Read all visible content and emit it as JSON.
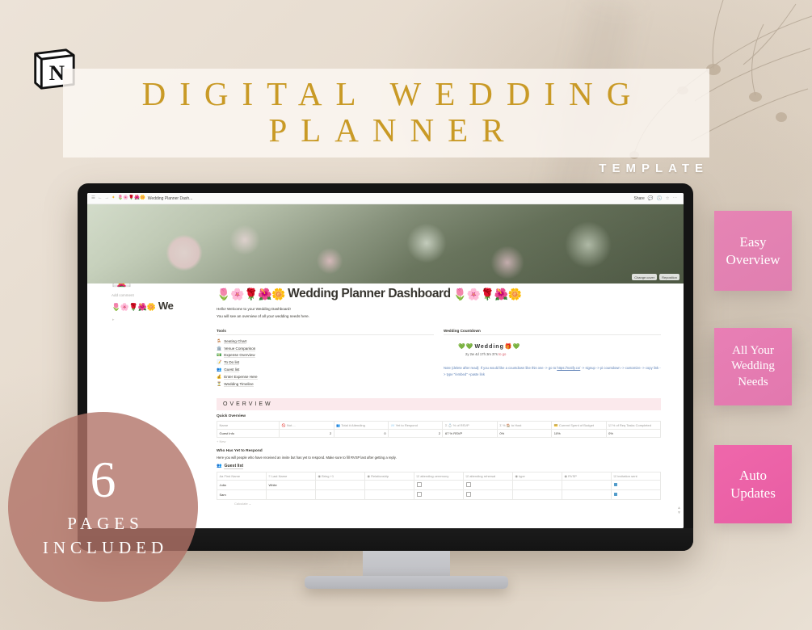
{
  "poster": {
    "title_line1": "DIGITAL WEDDING",
    "title_line2": "PLANNER",
    "template_word": "TEMPLATE",
    "logo_letter": "N",
    "badges": [
      {
        "text": "Easy\nOverview"
      },
      {
        "text": "All Your\nWedding\nNeeds"
      },
      {
        "text": "Auto\nUpdates"
      }
    ],
    "badge1_line1": "Easy",
    "badge1_line2": "Overview",
    "badge2_line1": "All Your",
    "badge2_line2": "Wedding",
    "badge2_line3": "Needs",
    "badge3_line1": "Auto",
    "badge3_line2": "Updates",
    "circle_number": "6",
    "circle_line1": "PAGES",
    "circle_line2": "INCLUDED",
    "accent_gold": "#c99a26",
    "accent_pink": "#e87fb5",
    "accent_rose": "#b27368"
  },
  "notion": {
    "topbar": {
      "menu_icon": "☰",
      "back_icon": "←",
      "forward_icon": "→",
      "star_icon": "✦",
      "breadcrumb_emojis": "🌷🌸🌹🌺🌼",
      "breadcrumb": "Wedding Planner Dash...",
      "share_label": "Share",
      "comment_icon": "💬",
      "clock_icon": "🕓",
      "favorite_icon": "☆",
      "more_icon": "⋯"
    },
    "cover": {
      "change_cover_label": "Change cover",
      "reposition_label": "Reposition"
    },
    "page": {
      "page_icon": "👰",
      "add_comment_label": "Add comment",
      "left_title_emojis": "🌷🌸🌹🌺🌼",
      "left_title_text": "We",
      "title_emojis_left": "🌷🌸🌹🌺🌼",
      "title": "Wedding Planner Dashboard",
      "title_emojis_right": "🌷🌸🌹🌺🌼",
      "intro_line1": "Hello! Welcome to your Wedding Dashboard!",
      "intro_line2": "You will see an overview of all your wedding needs here."
    },
    "tools": {
      "heading": "Tools",
      "items": [
        {
          "emoji": "🪑",
          "label": "Seating Chart"
        },
        {
          "emoji": "🏛️",
          "label": "Venue Comparison"
        },
        {
          "emoji": "💵",
          "label": "Expense Overview"
        },
        {
          "emoji": "📝",
          "label": "To Do list"
        },
        {
          "emoji": "👥",
          "label": "Guest list"
        },
        {
          "emoji": "💰",
          "label": "Enter Expense Here"
        },
        {
          "emoji": "⏳",
          "label": "Wedding Timeline"
        }
      ]
    },
    "countdown": {
      "heading": "Wedding Countdown",
      "widget_emoji_left": "💚💚",
      "widget_title": "Wedding",
      "widget_emoji_right": "🎁💚",
      "time_remaining": "2y 2w 4d 17h 3m 37s",
      "time_suffix": "to go",
      "note": "Note (delete after read): If you would like a countdown like this one -> go to",
      "note_link": "https://notify.co/",
      "note_tail": "-> signup -> pi countdown -> customize -> copy link -> type \"/embed\" +paste link"
    },
    "overview": {
      "band_title": "OVERVIEW",
      "quick_overview_heading": "Quick Overview",
      "columns": [
        "Name",
        "🚫 Not ...",
        "👥 Total # Attending",
        "📨 Yet to Respond",
        "Σ 💍 % of RSVP",
        "Σ % 🏠 to Host",
        "💳 Current Spent of Budget",
        "☑ % of Req Tasks Completed"
      ],
      "rows": [
        {
          "name": "Guest Info",
          "not_attending": "2",
          "total_attending": "0",
          "yet_to_respond": "2",
          "pct_rsvp": "67 % RSVP",
          "pct_to_host": "0%",
          "current_spent": "10%",
          "pct_tasks": "0%"
        }
      ],
      "new_row_label": "+ New"
    },
    "respond": {
      "heading": "Who Has Yet to Respond",
      "description": "Here you will people who have received an invite but has yet to respond. Make sure to fill RVSP last after getting a reply.",
      "db_emoji": "👥",
      "db_title": "Guest list",
      "columns": [
        "Aa First Name",
        "≡ Last Name",
        "◉ Bring +1",
        "◉ Relationship",
        "☑ attending ceremony",
        "☑ attending rehersal",
        "◉ type",
        "◉ RVSP",
        "☑ invitation sent"
      ],
      "rows": [
        {
          "first_name": "Julia",
          "last_name": "White",
          "bring_plus_one": "",
          "relationship": "",
          "attending_ceremony": "unchecked",
          "attending_rehersal": "unchecked",
          "type": "",
          "rvsp": "",
          "invitation_sent": "checked"
        },
        {
          "first_name": "Sam",
          "last_name": "",
          "bring_plus_one": "",
          "relationship": "",
          "attending_ceremony": "unchecked",
          "attending_rehersal": "unchecked",
          "type": "",
          "rvsp": "",
          "invitation_sent": "checked"
        }
      ],
      "calculate_label": "Calculate ⌄"
    }
  }
}
